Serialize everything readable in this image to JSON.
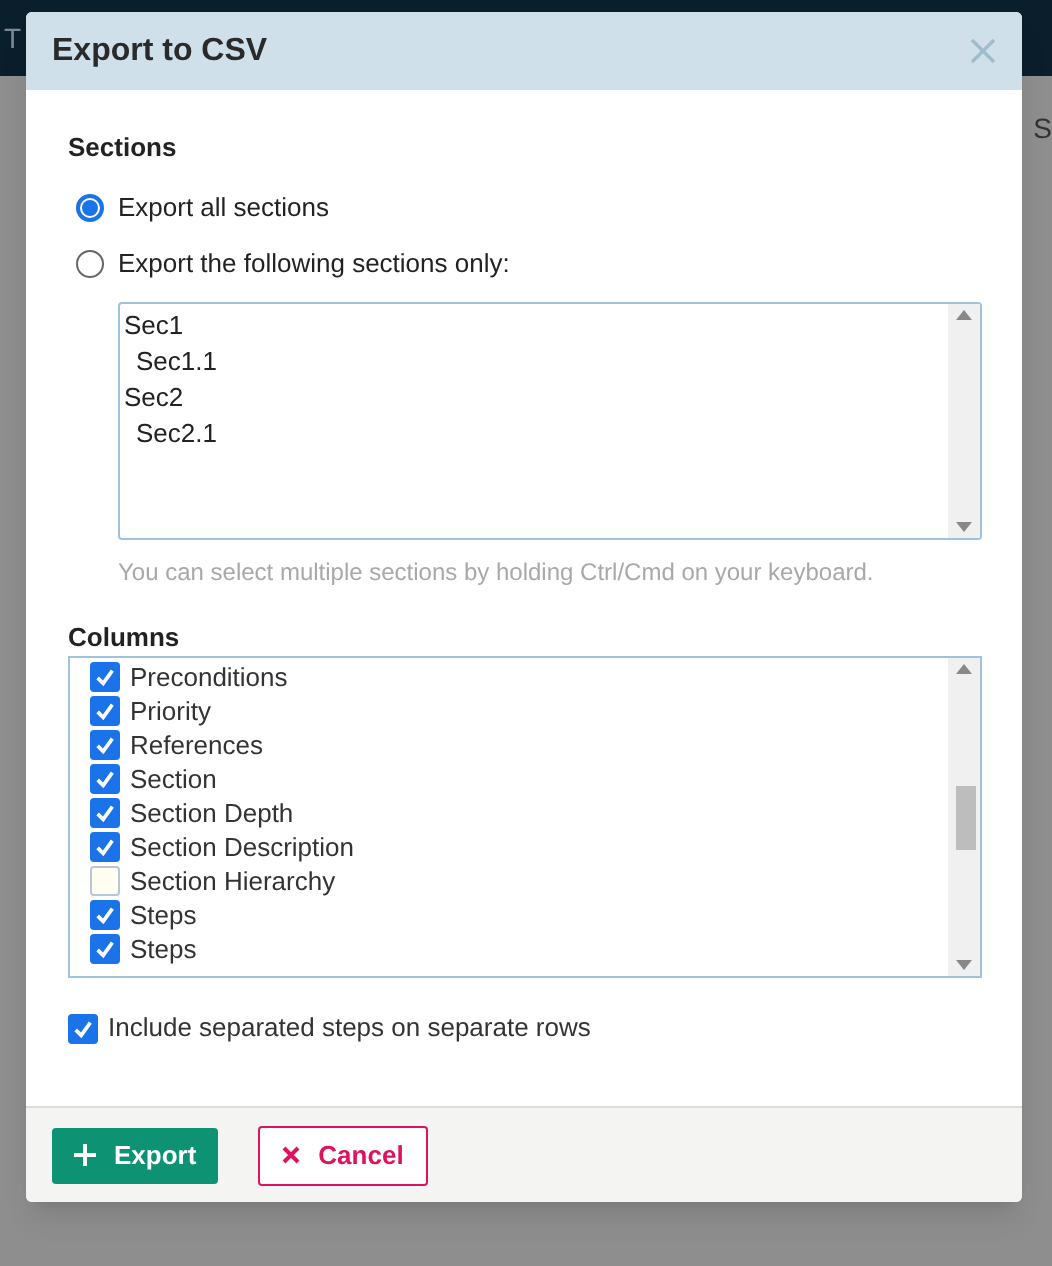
{
  "background": {
    "header_text": "T",
    "side_text": "S"
  },
  "dialog": {
    "title": "Export to CSV",
    "sections_heading": "Sections",
    "section_modes": [
      {
        "label": "Export all sections",
        "selected": true
      },
      {
        "label": "Export the following sections only:",
        "selected": false
      }
    ],
    "sections": [
      {
        "label": "Sec1",
        "children": [
          {
            "label": "Sec1.1"
          }
        ]
      },
      {
        "label": "Sec2",
        "children": [
          {
            "label": "Sec2.1"
          }
        ]
      }
    ],
    "sections_hint": "You can select multiple sections by holding Ctrl/Cmd on your keyboard.",
    "columns_heading": "Columns",
    "columns": [
      {
        "label": "Preconditions",
        "checked": true
      },
      {
        "label": "Priority",
        "checked": true
      },
      {
        "label": "References",
        "checked": true
      },
      {
        "label": "Section",
        "checked": true
      },
      {
        "label": "Section Depth",
        "checked": true
      },
      {
        "label": "Section Description",
        "checked": true
      },
      {
        "label": "Section Hierarchy",
        "checked": false
      },
      {
        "label": "Steps",
        "checked": true
      },
      {
        "label": "Steps",
        "checked": true
      }
    ],
    "separate_steps": {
      "label": "Include separated steps on separate rows",
      "checked": true
    },
    "buttons": [
      {
        "kind": "primary",
        "label": "Export"
      },
      {
        "kind": "cancel",
        "label": "Cancel"
      }
    ]
  }
}
